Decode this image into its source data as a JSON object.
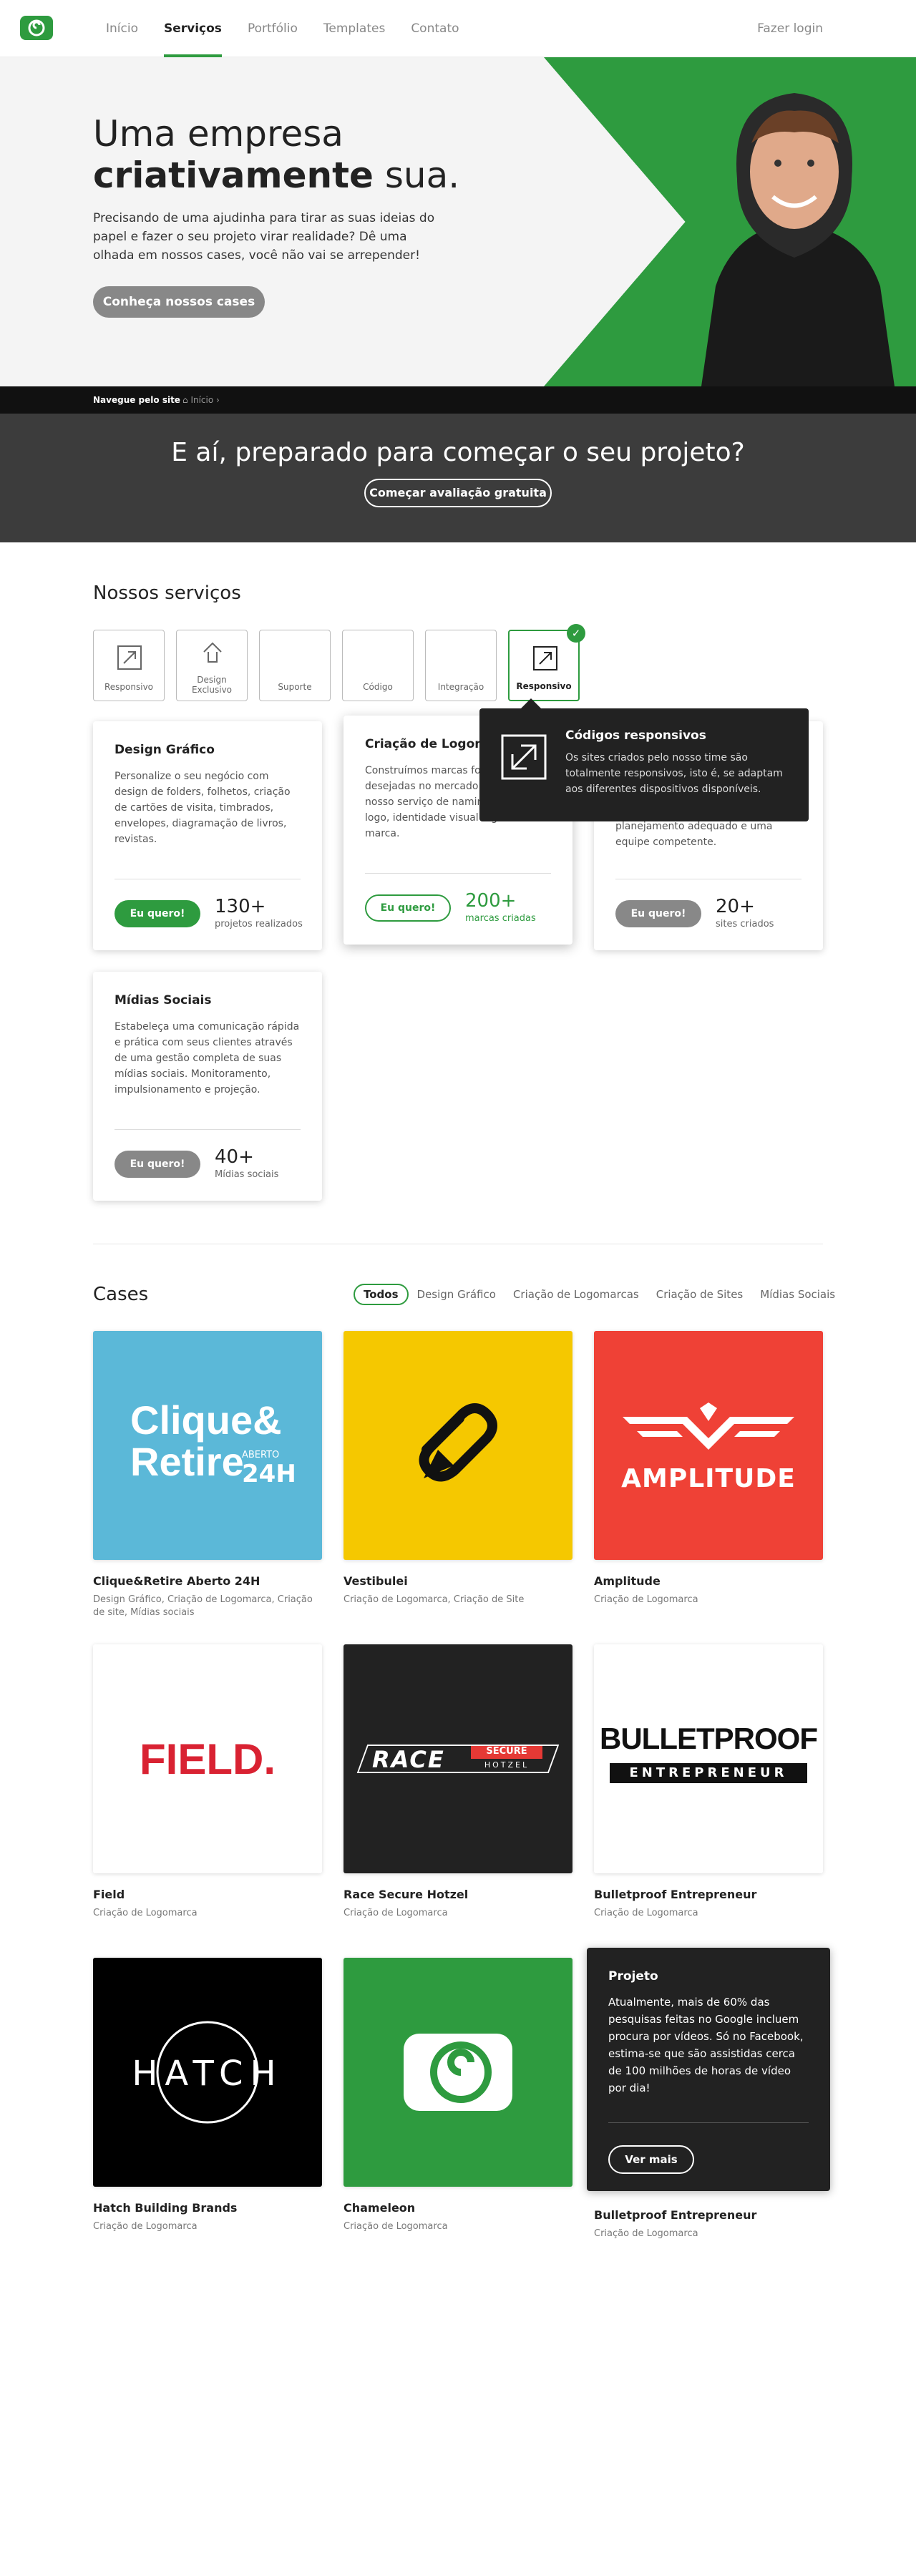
{
  "header": {
    "nav": [
      "Início",
      "Serviços",
      "Portfólio",
      "Templates",
      "Contato"
    ],
    "login": "Fazer login"
  },
  "hero": {
    "title_line1": "Uma empresa",
    "title_bold": "criativamente",
    "title_end": " sua.",
    "text": "Precisando de uma ajudinha para tirar as suas ideias do papel e fazer o seu projeto virar realidade? Dê uma olhada em nossos cases, você não vai se arrepender!",
    "button": "Conheça nossos cases"
  },
  "crumb": {
    "label": "Navegue pelo site",
    "home": "Início ›"
  },
  "cta": {
    "title": "E aí, preparado para começar o seu projeto?",
    "button": "Começar avaliação gratuita"
  },
  "services": {
    "title": "Nossos serviços",
    "tabs": [
      "Responsivo",
      "Design Exclusivo",
      "Suporte",
      "Código",
      "Integração",
      "Responsivo"
    ],
    "cards": [
      {
        "title": "Design Gráfico",
        "text": "Personalize o seu negócio com design de folders, folhetos, criação de cartões de visita, timbrados, envelopes, diagramação de livros, revistas.",
        "button": "Eu quero!",
        "num": "130+",
        "unit": "projetos realizados"
      },
      {
        "title": "Criação de Logomarca",
        "text": "Construímos marcas fortes e desejadas no mercado através do nosso serviço de naming, criação do logo, identidade visual e gestão de marca.",
        "button": "Eu quero!",
        "num": "200+",
        "unit": "marcas criadas"
      },
      {
        "title": "",
        "text": "planejamento adequado e uma equipe competente.",
        "button": "Eu quero!",
        "num": "20+",
        "unit": "sites criados"
      },
      {
        "title": "Mídias Sociais",
        "text": "Estabeleça uma comunicação rápida e prática com seus clientes através de uma gestão completa de suas mídias sociais. Monitoramento, impulsionamento e projeção.",
        "button": "Eu quero!",
        "num": "40+",
        "unit": "Mídias sociais"
      }
    ],
    "tooltip": {
      "title": "Códigos responsivos",
      "text": "Os sites criados pelo nosso time são totalmente responsivos, isto é, se adaptam aos diferentes dispositivos disponíveis."
    }
  },
  "cases": {
    "title": "Cases",
    "filters": [
      "Todos",
      "Design Gráfico",
      "Criação de Logomarcas",
      "Criação de Sites",
      "Mídias Sociais"
    ],
    "items": [
      {
        "name": "Clique&Retire Aberto 24H",
        "cat": "Design Gráfico, Criação de Logomarca, Criação de site, Mídias sociais",
        "logo1": "Clique&",
        "logo2": "Retire",
        "logo3": "ABERTO",
        "logo4": "24H"
      },
      {
        "name": "Vestibulei",
        "cat": "Criação de Logomarca, Criação de Site"
      },
      {
        "name": "Amplitude",
        "cat": "Criação de Logomarca",
        "logo": "AMPLITUDE"
      },
      {
        "name": "Field",
        "cat": "Criação de Logomarca",
        "logo": "FIELD."
      },
      {
        "name": "Race Secure Hotzel",
        "cat": "Criação de Logomarca",
        "logo": "RACE",
        "logo2": "SECURE",
        "logo3": "HOTZEL"
      },
      {
        "name": "Bulletproof Entrepreneur",
        "cat": "Criação de Logomarca",
        "logo": "BULLETPROOF",
        "logo2": "ENTREPRENEUR"
      },
      {
        "name": "Hatch Building Brands",
        "cat": "Criação de Logomarca",
        "logo": "HATCH"
      },
      {
        "name": "Chameleon",
        "cat": "Criação de Logomarca"
      },
      {
        "name": "Bulletproof Entrepreneur",
        "cat": "Criação de Logomarca"
      }
    ],
    "project": {
      "title": "Projeto",
      "text": "Atualmente, mais de 60% das pesquisas feitas no Google incluem procura por vídeos. Só no Facebook, estima-se que são assistidas cerca de 100 milhões de horas de vídeo por dia!",
      "button": "Ver mais"
    }
  },
  "colors": {
    "brand": "#2e9b3f",
    "dark": "#222222",
    "grey": "#888888"
  }
}
